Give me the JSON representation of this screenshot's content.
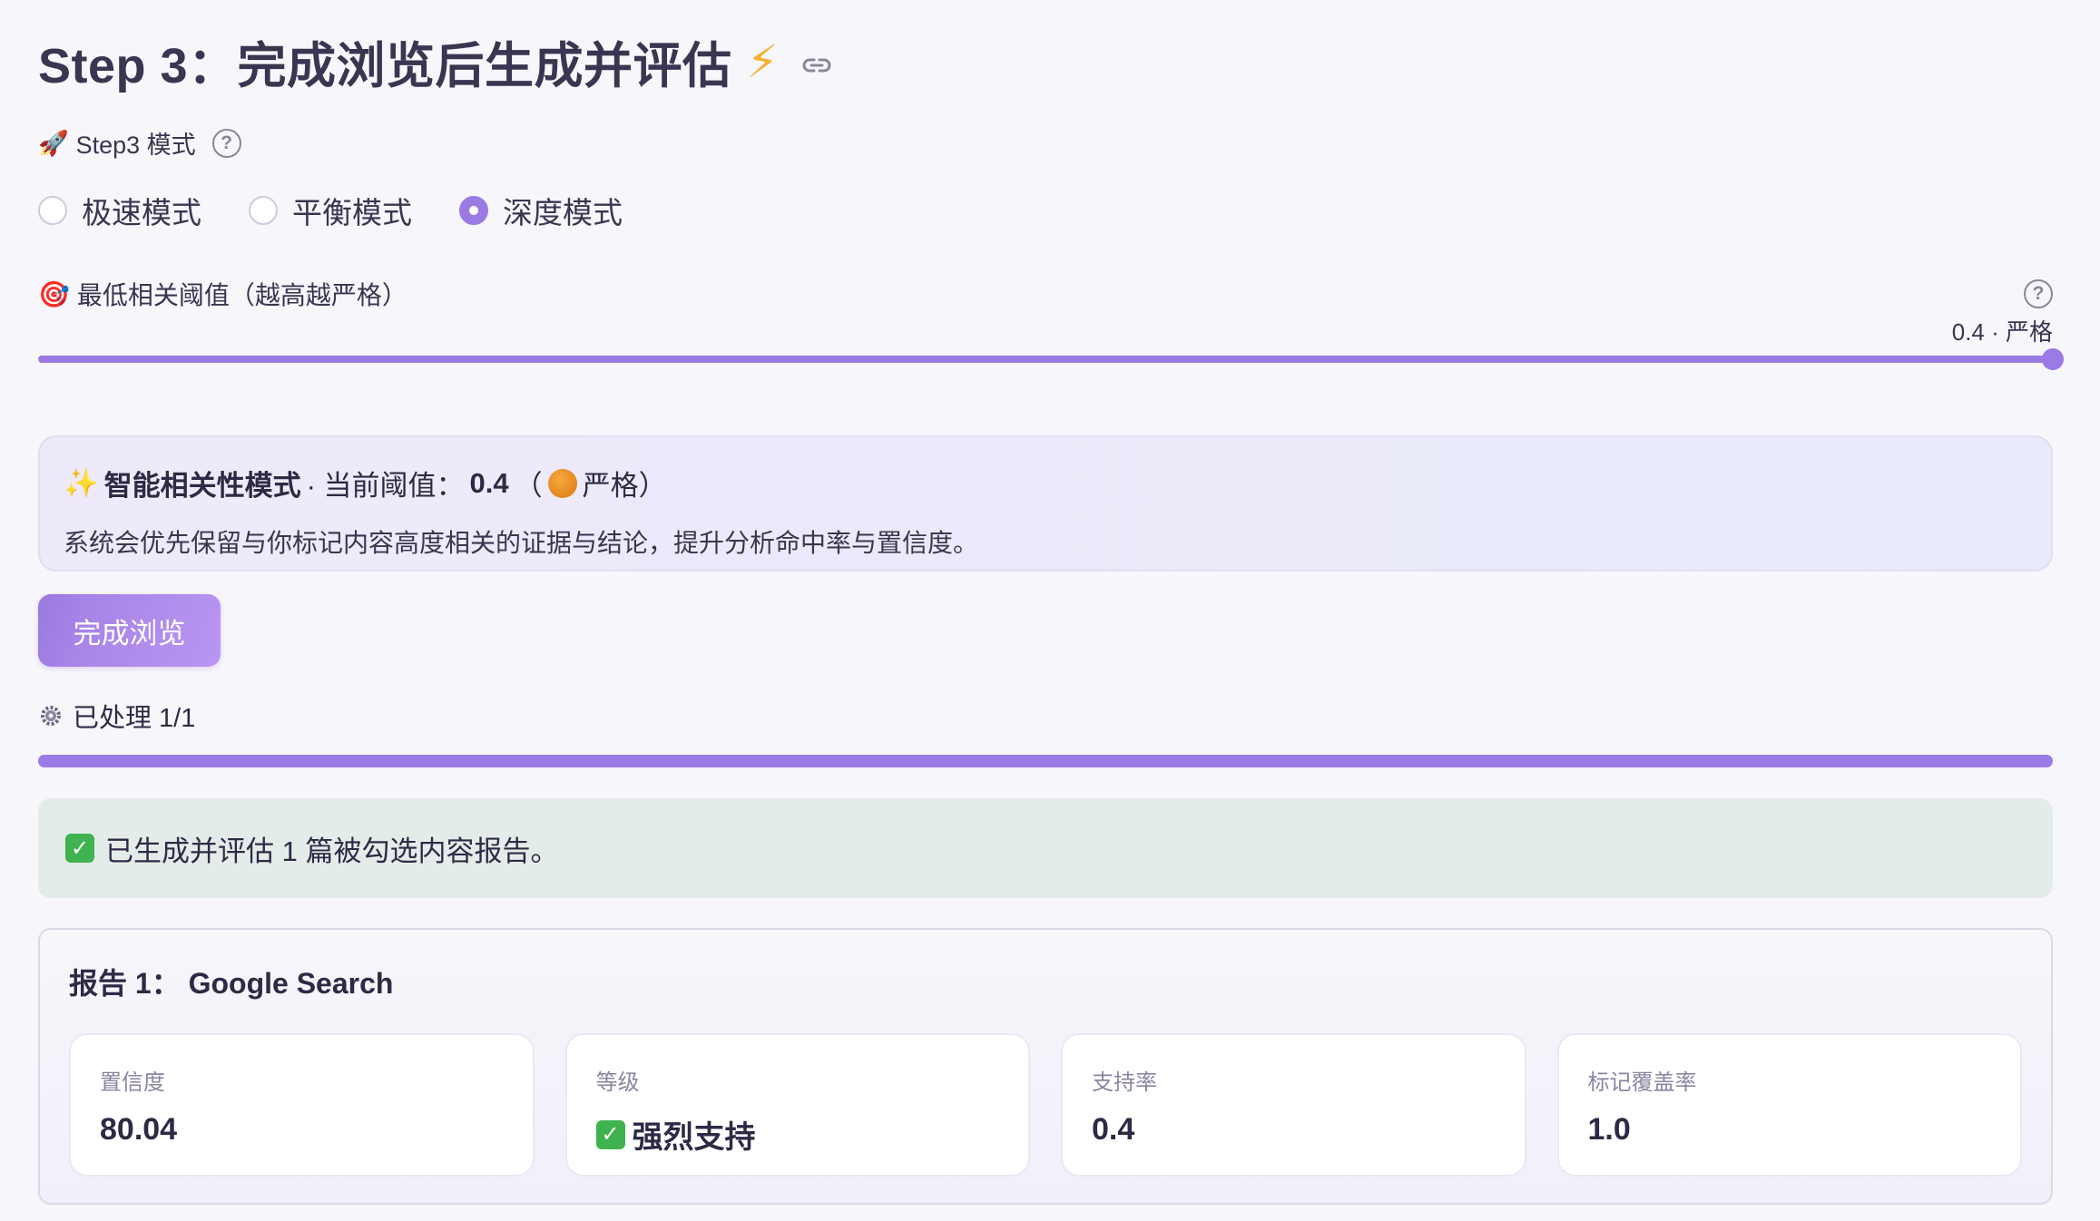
{
  "heading": {
    "title": "Step 3：完成浏览后生成并评估",
    "bolt_icon": "⚡"
  },
  "mode": {
    "icon": "🚀",
    "label": "Step3 模式",
    "options": [
      "极速模式",
      "平衡模式",
      "深度模式"
    ],
    "selected": "深度模式"
  },
  "threshold": {
    "icon": "🎯",
    "label": "最低相关阈值（越高越严格）",
    "value_text": "0.4 · 严格",
    "value": 0.4,
    "fill_fraction": 1.0
  },
  "info": {
    "sparkle_icon": "✨",
    "title_bold": "智能相关性模式",
    "title_rest": " · 当前阈值：",
    "threshold_value": "0.4",
    "paren_open": "（",
    "level_text": "严格）",
    "description": "系统会优先保留与你标记内容高度相关的证据与结论，提升分析命中率与置信度。"
  },
  "button": {
    "label": "完成浏览"
  },
  "progress": {
    "label": "已处理 1/1",
    "fraction": 1.0
  },
  "success": {
    "message": "已生成并评估 1 篇被勾选内容报告。"
  },
  "report": {
    "title": "报告 1：  Google Search",
    "metrics": [
      {
        "label": "置信度",
        "value": "80.04"
      },
      {
        "label": "等级",
        "value": "强烈支持"
      },
      {
        "label": "支持率",
        "value": "0.4"
      },
      {
        "label": "标记覆盖率",
        "value": "1.0"
      }
    ]
  },
  "colors": {
    "accent": "#9b7ae3",
    "success_bg": "#e4ece9",
    "check_green": "#3fb34f",
    "warning_orange": "#e48a1e"
  }
}
